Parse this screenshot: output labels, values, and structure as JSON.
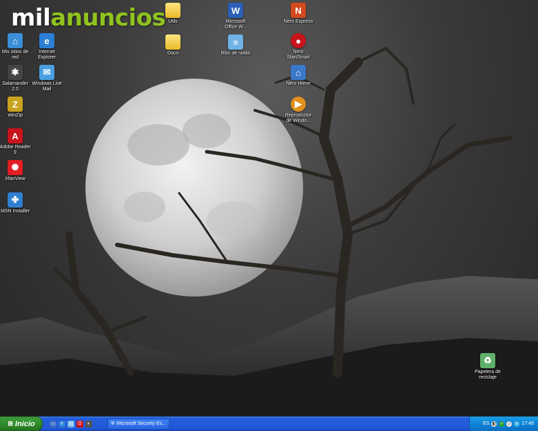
{
  "watermark": {
    "part1": "mil",
    "part2": "anuncios"
  },
  "desktop_icons": [
    {
      "label": "Mis sitios de\nred",
      "icon": "network-places-icon"
    },
    {
      "label": "Internet\nExplorer",
      "icon": "internet-explorer-icon"
    },
    {
      "label": "Salamander\n2.0",
      "icon": "salamander-icon"
    },
    {
      "label": "Windows Live\nMail",
      "icon": "windows-live-mail-icon"
    },
    {
      "label": "WinZip",
      "icon": "winzip-icon"
    },
    {
      "label": "Adobe Reader\n9",
      "icon": "adobe-reader-icon"
    },
    {
      "label": "IrfanView",
      "icon": "irfanview-icon"
    },
    {
      "label": "MSN Installer",
      "icon": "msn-installer-icon"
    },
    {
      "label": "Utils",
      "icon": "folder-icon"
    },
    {
      "label": "Docs",
      "icon": "folder-icon"
    },
    {
      "label": "Microsoft\nOffice W...",
      "icon": "office-word-icon"
    },
    {
      "label": "Bloc de notas",
      "icon": "notepad-icon"
    },
    {
      "label": "Nero Express",
      "icon": "nero-express-icon"
    },
    {
      "label": "Nero\nStartSmart",
      "icon": "nero-startsmart-icon"
    },
    {
      "label": "Nero Home",
      "icon": "nero-home-icon"
    },
    {
      "label": "Reproductor\nde Windo...",
      "icon": "media-player-icon"
    },
    {
      "label": "Papelera de\nreciclaje",
      "icon": "recycle-bin-icon"
    }
  ],
  "taskbar": {
    "start_label": "Inicio",
    "task_button": "Microsoft Security Es...",
    "language": "ES",
    "clock": "17:46"
  },
  "colors": {
    "taskbar": "#245edc",
    "start": "#2f8a2c",
    "tray": "#0f83d6"
  }
}
